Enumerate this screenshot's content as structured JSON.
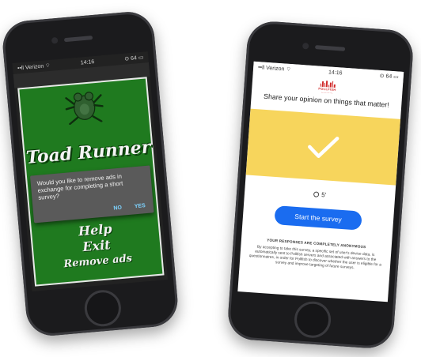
{
  "left_phone": {
    "status": {
      "carrier": "••ll Verizon ⌔",
      "time": "14:16",
      "indicators": "⊙ 64 ▭"
    },
    "game": {
      "title": "Toad Runner",
      "menu": [
        "Help",
        "Exit",
        "Remove ads"
      ],
      "dialog": {
        "message": "Would you like to remove ads in exchange for completing a short survey?",
        "no_label": "NO",
        "yes_label": "YES"
      }
    }
  },
  "right_phone": {
    "status": {
      "carrier": "••ll Verizon ⌔",
      "time": "14:16",
      "indicators": "⊙ 64 ▭"
    },
    "brand": {
      "name": "POLLFISH",
      "sub": "— — — —"
    },
    "headline": "Share your opinion on things that matter!",
    "timer": "5'",
    "start_label": "Start the survey",
    "anon_heading": "YOUR RESPONSES ARE COMPLETELY ANONYMOUS",
    "legal": "By accepting to take this survey, a specific set of user's device data, is automatically sent to Pollfish servers and associated with answers to the questionnaires, in order for Pollfish to discover whether the user is eligible for a survey and improve targeting of future surveys.",
    "colors": {
      "accent": "#1a6cf0",
      "highlight": "#f7d55c",
      "brand": "#d12a2a"
    }
  },
  "icons": [
    "toad-icon",
    "check-icon",
    "clock-icon",
    "pollfish-logo-icon"
  ]
}
